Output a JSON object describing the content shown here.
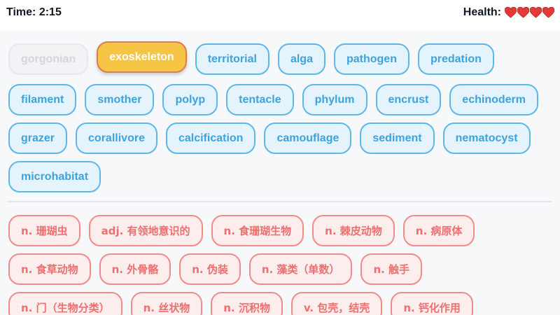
{
  "header": {
    "time_label": "Time: 2:15",
    "health_label": "Health:",
    "hearts": 4,
    "heart_color": "#e53935"
  },
  "english_rows": [
    [
      {
        "text": "gorgonian",
        "state": "disabled"
      },
      {
        "text": "exoskeleton",
        "state": "selected"
      },
      {
        "text": "territorial",
        "state": "normal"
      },
      {
        "text": "alga",
        "state": "normal"
      },
      {
        "text": "pathogen",
        "state": "normal"
      },
      {
        "text": "predation",
        "state": "normal"
      }
    ],
    [
      {
        "text": "filament",
        "state": "normal"
      },
      {
        "text": "smother",
        "state": "normal"
      },
      {
        "text": "polyp",
        "state": "normal"
      },
      {
        "text": "tentacle",
        "state": "normal"
      },
      {
        "text": "phylum",
        "state": "normal"
      },
      {
        "text": "encrust",
        "state": "normal"
      },
      {
        "text": "echinoderm",
        "state": "normal"
      }
    ],
    [
      {
        "text": "grazer",
        "state": "normal"
      },
      {
        "text": "corallivore",
        "state": "normal"
      },
      {
        "text": "calcification",
        "state": "normal"
      },
      {
        "text": "camouflage",
        "state": "normal"
      },
      {
        "text": "sediment",
        "state": "normal"
      },
      {
        "text": "nematocyst",
        "state": "normal"
      }
    ],
    [
      {
        "text": "microhabitat",
        "state": "normal"
      }
    ]
  ],
  "chinese_rows": [
    [
      "n. 珊瑚虫",
      "adj. 有领地意识的",
      "n. 食珊瑚生物",
      "n. 棘皮动物",
      "n. 病原体"
    ],
    [
      "n. 食草动物",
      "n. 外骨骼",
      "n. 伪装",
      "n. 藻类（单数）",
      "n. 触手"
    ],
    [
      "n. 门（生物分类）",
      "n. 丝状物",
      "n. 沉积物",
      "v. 包壳，结壳",
      "n. 钙化作用"
    ]
  ],
  "colors": {
    "english_chip_bg": "#e4f3fc",
    "english_chip_border": "#5db7ea",
    "english_chip_text": "#3da3de",
    "selected_chip_bg": "#f6c545",
    "selected_chip_border": "#e07b4b",
    "chinese_chip_bg": "#fdeeee",
    "chinese_chip_border": "#f08b8b",
    "chinese_chip_text": "#ee6f6f"
  }
}
